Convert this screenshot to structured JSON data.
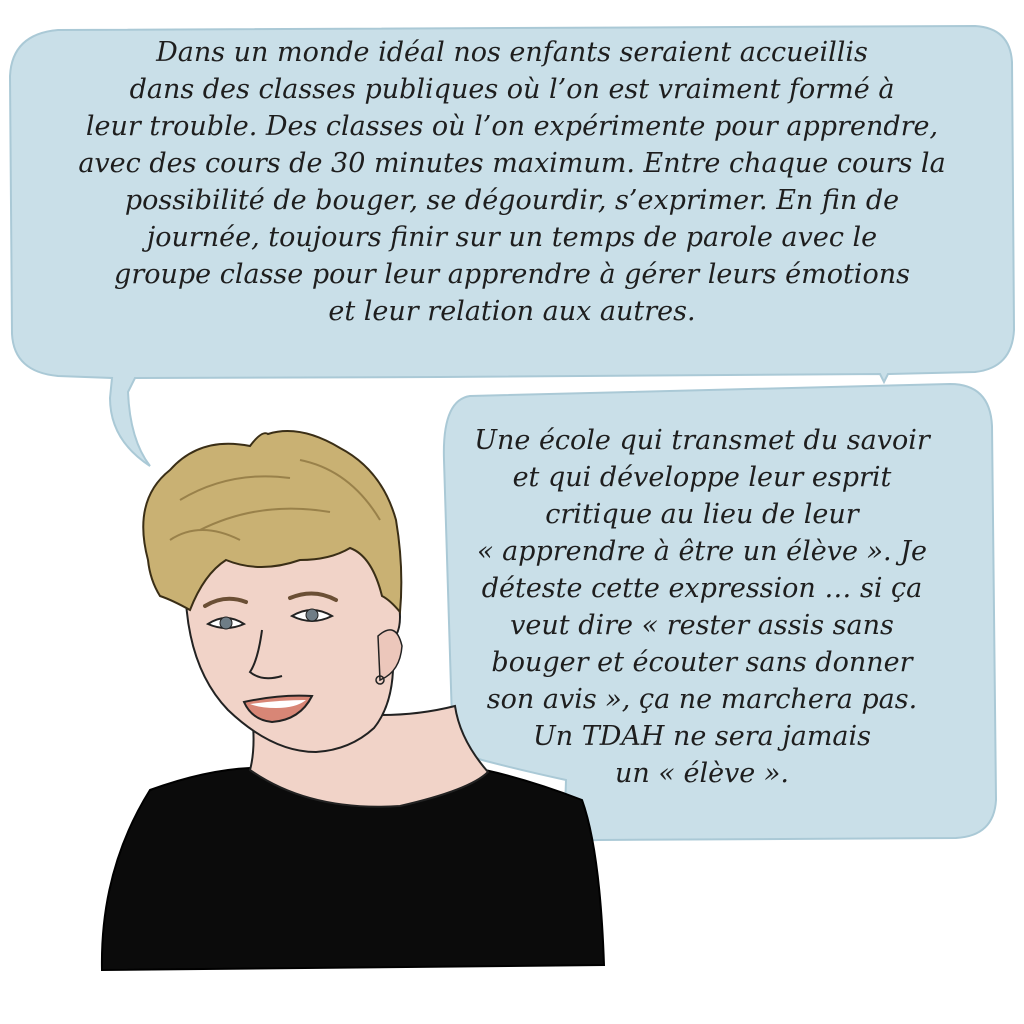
{
  "bubbles": {
    "top": {
      "text": "Dans un monde idéal nos enfants seraient accueillis\ndans des classes publiques où l’on est vraiment formé à\nleur trouble. Des classes où l’on expérimente pour apprendre,\navec des cours de 30 minutes maximum. Entre chaque cours la\npossibilité de bouger, se dégourdir, s’exprimer. En fin de\njournée, toujours finir sur un temps de parole avec le\ngroupe classe pour leur apprendre à gérer leurs émotions\net leur relation aux autres."
    },
    "right": {
      "text": "Une école qui transmet du savoir\net qui développe leur esprit\ncritique au lieu de leur\n« apprendre à être un élève ». Je\ndéteste cette expression … si ça\nveut dire « rester assis sans\nbouger et écouter sans donner\nson avis », ça ne marchera pas.\nUn TDAH ne sera jamais\nun « élève »."
    }
  },
  "colors": {
    "bubble_fill": "#c9dfe8",
    "bubble_stroke": "#aac9d6",
    "hair": "#c9b173",
    "skin": "#f1d3c8",
    "shirt": "#0b0b0b"
  }
}
